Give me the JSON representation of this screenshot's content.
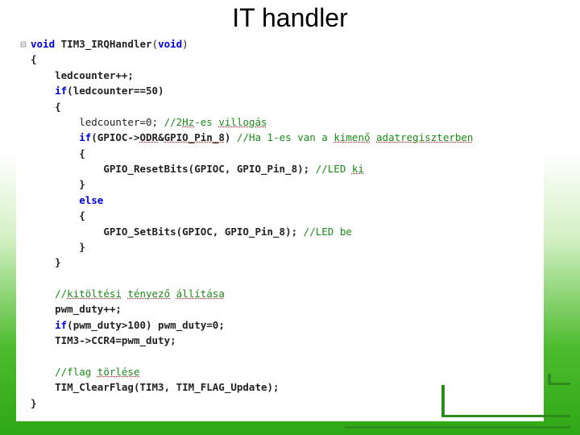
{
  "title": "IT handler",
  "code": {
    "l1_gutter": "⊟",
    "l1_kw1": "void",
    "l1_fn": "TIM3_IRQHandler",
    "l1_kw2": "void",
    "l2": "{",
    "l3": "ledcounter++;",
    "l4_kw": "if",
    "l4_rest": "(ledcounter==50)",
    "l5": "{",
    "l6_a": "ledcounter=0;",
    "l6_c_pre": " //2",
    "l6_c_u1": "Hz",
    "l6_c_mid": "-es ",
    "l6_c_u2": "villogás",
    "l7_kw": "if",
    "l7_a": "(GPIOC->",
    "l7_u1": "ODR",
    "l7_b": "&",
    "l7_u2": "GPIO_Pin_8",
    "l7_c": ")",
    "l7_cpre": " //Ha 1-es van a ",
    "l7_cu1": "kimenő",
    "l7_cmid": " ",
    "l7_cu2": "adatregiszterben",
    "l8": "{",
    "l9_a": "GPIO_ResetBits(GPIOC, GPIO_Pin_8);",
    "l9_c": " //LED ",
    "l9_cu": "ki",
    "l10": "}",
    "l11_kw": "else",
    "l12": "{",
    "l13_a": "GPIO_SetBits(GPIOC, GPIO_Pin_8);",
    "l13_c": " //LED be",
    "l14": "}",
    "l15": "}",
    "l17_c": "//",
    "l17_u1": "kitöltési",
    "l17_s1": " ",
    "l17_u2": "tényező",
    "l17_s2": " ",
    "l17_u3": "állítása",
    "l18": "pwm_duty++;",
    "l19_kw": "if",
    "l19_rest": "(pwm_duty>100) pwm_duty=0;",
    "l20": "TIM3->CCR4=pwm_duty;",
    "l22_c": "//flag ",
    "l22_u": "törlése",
    "l23": "TIM_ClearFlag(TIM3, TIM_FLAG_Update);",
    "l24": "}"
  }
}
